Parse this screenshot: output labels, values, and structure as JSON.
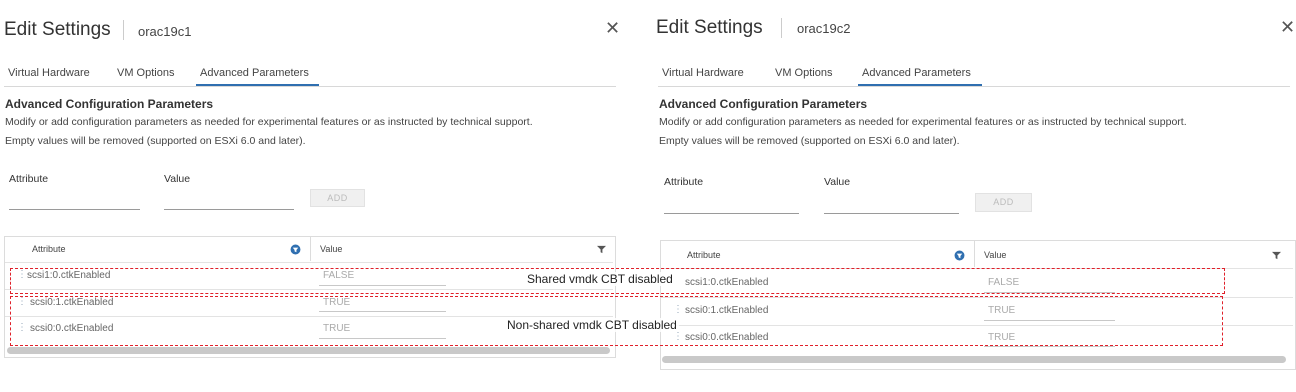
{
  "dialogs": [
    {
      "title": "Edit Settings",
      "vm_name": "orac19c1",
      "tabs": [
        "Virtual Hardware",
        "VM Options",
        "Advanced Parameters"
      ],
      "active_tab": "Advanced Parameters",
      "heading": "Advanced Configuration Parameters",
      "desc_line1": "Modify or add configuration parameters as needed for experimental features or as instructed by technical support.",
      "desc_line2": "Empty values will be removed (supported on ESXi 6.0 and later).",
      "form": {
        "attribute_label": "Attribute",
        "value_label": "Value",
        "add_label": "ADD"
      },
      "grid": {
        "col_attribute": "Attribute",
        "col_value": "Value",
        "rows": [
          {
            "attribute": "scsi1:0.ctkEnabled",
            "value": "FALSE"
          },
          {
            "attribute": "scsi0:1.ctkEnabled",
            "value": "TRUE"
          },
          {
            "attribute": "scsi0:0.ctkEnabled",
            "value": "TRUE"
          }
        ]
      }
    },
    {
      "title": "Edit Settings",
      "vm_name": "orac19c2",
      "tabs": [
        "Virtual Hardware",
        "VM Options",
        "Advanced Parameters"
      ],
      "active_tab": "Advanced Parameters",
      "heading": "Advanced Configuration Parameters",
      "desc_line1": "Modify or add configuration parameters as needed for experimental features or as instructed by technical support.",
      "desc_line2": "Empty values will be removed (supported on ESXi 6.0 and later).",
      "form": {
        "attribute_label": "Attribute",
        "value_label": "Value",
        "add_label": "ADD"
      },
      "grid": {
        "col_attribute": "Attribute",
        "col_value": "Value",
        "rows": [
          {
            "attribute": "scsi1:0.ctkEnabled",
            "value": "FALSE"
          },
          {
            "attribute": "scsi0:1.ctkEnabled",
            "value": "TRUE"
          },
          {
            "attribute": "scsi0:0.ctkEnabled",
            "value": "TRUE"
          }
        ]
      }
    }
  ],
  "annotations": {
    "shared": "Shared vmdk CBT disabled",
    "non_shared": "Non-shared vmdk CBT disabled"
  },
  "colors": {
    "accent": "#2f6fb0",
    "annotation": "#e0202a"
  },
  "icons": [
    "close-icon",
    "filter-icon",
    "drag-handle-icon"
  ]
}
